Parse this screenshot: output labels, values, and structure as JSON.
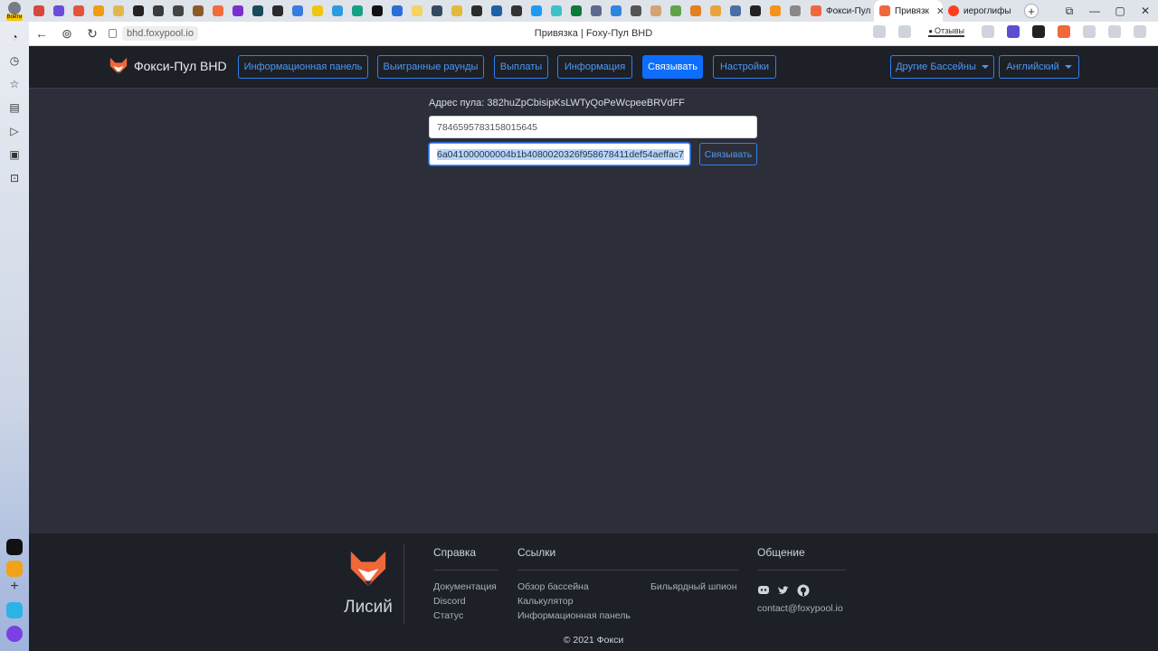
{
  "browser": {
    "profile_label": "Войти",
    "tabs": [
      {
        "label": "Фокси-Пул",
        "active": false
      },
      {
        "label": "Привязк",
        "active": true
      },
      {
        "label": "иероглифы",
        "active": false
      }
    ],
    "new_tab_label": "+",
    "address": "bhd.foxypool.io",
    "page_title": "Привязка | Foxy-Пул BHD",
    "reviews_label": "Отзывы",
    "window_controls": [
      "⧉",
      "—",
      "▢",
      "✕"
    ]
  },
  "navbar": {
    "brand": "Фокси-Пул BHD",
    "items": [
      {
        "label": "Информационная панель"
      },
      {
        "label": "Выигранные раунды"
      },
      {
        "label": "Выплаты"
      },
      {
        "label": "Информация"
      },
      {
        "label": "Связывать",
        "active": true
      },
      {
        "label": "Настройки"
      }
    ],
    "other_pools": "Другие Бассейны",
    "language": "Английский"
  },
  "bind_form": {
    "pool_address_label": "Адрес пула:",
    "pool_address_value": "382huZpCbisipKsLWTyQoPeWcpeeBRVdFF",
    "account_id_value": "7846595783158015645",
    "signature_value": "6a041000000004b1b4080020326f958678411def54aeffac7",
    "submit_label": "Связывать"
  },
  "footer": {
    "logo_text": "Лисий",
    "help_heading": "Справка",
    "help_links": [
      "Документация",
      "Discord",
      "Статус"
    ],
    "links_heading": "Ссылки",
    "links_col1": [
      "Обзор бассейна",
      "Калькулятор",
      "Информационная панель"
    ],
    "links_col2": [
      "Бильярдный шпион"
    ],
    "community_heading": "Общение",
    "contact_email": "contact@foxypool.io",
    "copyright": "© 2021 Фокси"
  },
  "colors": {
    "accent": "#0d6efd",
    "outline": "#2f80ed",
    "navbar_bg": "#1d2027",
    "page_bg": "#2c2f39",
    "fox_orange": "#f0673a"
  }
}
